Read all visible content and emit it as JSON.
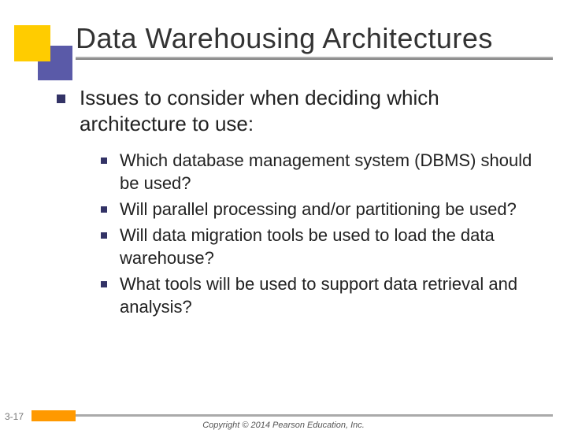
{
  "title": "Data Warehousing Architectures",
  "main_point": "Issues to consider when deciding which architecture to use:",
  "sub_points": [
    "Which database management system (DBMS) should be used?",
    "Will parallel processing and/or partitioning be used?",
    "Will data migration tools be used to load the data warehouse?",
    "What tools will be used to support data retrieval and analysis?"
  ],
  "slide_number": "3-17",
  "copyright": "Copyright © 2014 Pearson Education, Inc."
}
